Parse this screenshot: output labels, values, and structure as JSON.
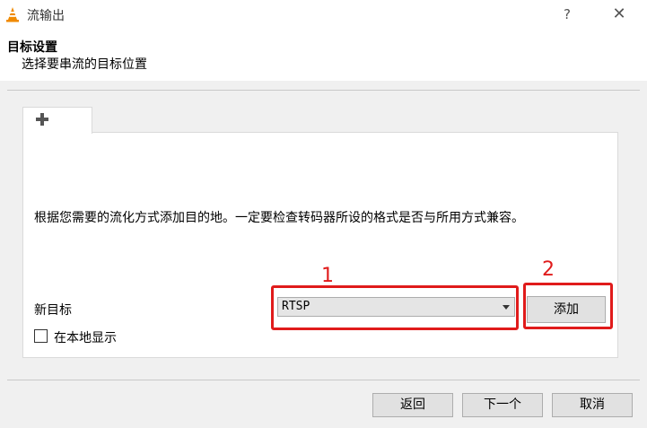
{
  "window": {
    "title": "流输出",
    "help_label": "?",
    "close_label": "✕"
  },
  "header": {
    "title": "目标设置",
    "subtitle": "选择要串流的目标位置"
  },
  "panel": {
    "description": "根据您需要的流化方式添加目的地。一定要检查转码器所设的格式是否与所用方式兼容。",
    "new_destination_label": "新目标",
    "destination_select": {
      "selected": "RTSP"
    },
    "add_button_label": "添加",
    "display_locally_label": "在本地显示",
    "display_locally_checked": false
  },
  "annotations": [
    {
      "number": "1"
    },
    {
      "number": "2"
    }
  ],
  "footer": {
    "back_label": "返回",
    "next_label": "下一个",
    "cancel_label": "取消"
  },
  "icons": {
    "app": "vlc-cone-icon",
    "tab": "plus-icon"
  },
  "colors": {
    "annotation": "#e01b1b",
    "vlc_orange": "#f08a00"
  }
}
